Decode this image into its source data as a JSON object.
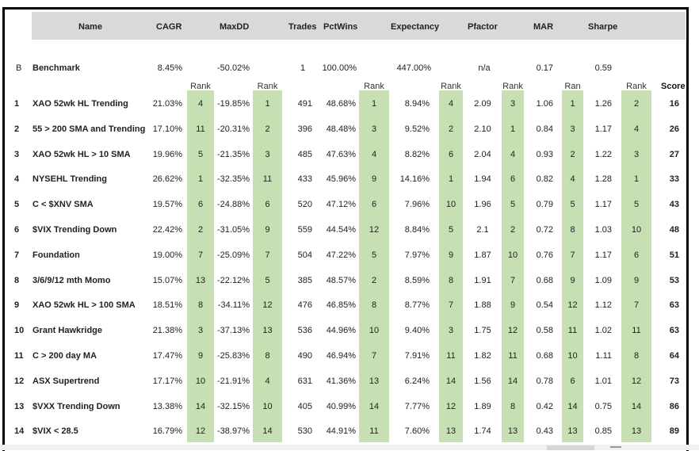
{
  "headers": {
    "name": "Name",
    "cagr": "CAGR",
    "maxdd": "MaxDD",
    "trades": "Trades",
    "pctwins": "PctWins",
    "expectancy": "Expectancy",
    "pfactor": "Pfactor",
    "mar": "MAR",
    "sharpe": "Sharpe",
    "score": "Score"
  },
  "rank_labels": [
    "Rank",
    "Rank",
    "Rank",
    "Rank",
    "Rank",
    "Ran",
    "Rank"
  ],
  "benchmark": {
    "id": "B",
    "name": "Benchmark",
    "cagr": "8.45%",
    "maxdd": "-50.02%",
    "trades": "1",
    "pctwins": "100.00%",
    "expectancy": "447.00%",
    "pfactor": "n/a",
    "mar": "0.17",
    "sharpe": "0.59"
  },
  "rows": [
    {
      "id": "1",
      "name": "XAO 52wk HL Trending",
      "cagr": "21.03%",
      "cagr_rank": "4",
      "maxdd": "-19.85%",
      "maxdd_rank": "1",
      "trades": "491",
      "pctwins": "48.68%",
      "pctwins_rank": "1",
      "expectancy": "8.94%",
      "expectancy_rank": "4",
      "pfactor": "2.09",
      "pfactor_rank": "3",
      "mar": "1.06",
      "mar_rank": "1",
      "sharpe": "1.26",
      "sharpe_rank": "2",
      "score": "16"
    },
    {
      "id": "2",
      "name": "55 > 200 SMA and Trending",
      "cagr": "17.10%",
      "cagr_rank": "11",
      "maxdd": "-20.31%",
      "maxdd_rank": "2",
      "trades": "396",
      "pctwins": "48.48%",
      "pctwins_rank": "3",
      "expectancy": "9.52%",
      "expectancy_rank": "2",
      "pfactor": "2.10",
      "pfactor_rank": "1",
      "mar": "0.84",
      "mar_rank": "3",
      "sharpe": "1.17",
      "sharpe_rank": "4",
      "score": "26"
    },
    {
      "id": "3",
      "name": "XAO 52wk HL > 10 SMA",
      "cagr": "19.96%",
      "cagr_rank": "5",
      "maxdd": "-21.35%",
      "maxdd_rank": "3",
      "trades": "485",
      "pctwins": "47.63%",
      "pctwins_rank": "4",
      "expectancy": "8.82%",
      "expectancy_rank": "6",
      "pfactor": "2.04",
      "pfactor_rank": "4",
      "mar": "0.93",
      "mar_rank": "2",
      "sharpe": "1.22",
      "sharpe_rank": "3",
      "score": "27"
    },
    {
      "id": "4",
      "name": "NYSEHL Trending",
      "cagr": "26.62%",
      "cagr_rank": "1",
      "maxdd": "-32.35%",
      "maxdd_rank": "11",
      "trades": "433",
      "pctwins": "45.96%",
      "pctwins_rank": "9",
      "expectancy": "14.16%",
      "expectancy_rank": "1",
      "pfactor": "1.94",
      "pfactor_rank": "6",
      "mar": "0.82",
      "mar_rank": "4",
      "sharpe": "1.28",
      "sharpe_rank": "1",
      "score": "33"
    },
    {
      "id": "5",
      "name": "C < $XNV SMA",
      "cagr": "19.57%",
      "cagr_rank": "6",
      "maxdd": "-24.88%",
      "maxdd_rank": "6",
      "trades": "520",
      "pctwins": "47.12%",
      "pctwins_rank": "6",
      "expectancy": "7.96%",
      "expectancy_rank": "10",
      "pfactor": "1.96",
      "pfactor_rank": "5",
      "mar": "0.79",
      "mar_rank": "5",
      "sharpe": "1.17",
      "sharpe_rank": "5",
      "score": "43"
    },
    {
      "id": "6",
      "name": "$VIX Trending Down",
      "cagr": "22.42%",
      "cagr_rank": "2",
      "maxdd": "-31.05%",
      "maxdd_rank": "9",
      "trades": "559",
      "pctwins": "44.54%",
      "pctwins_rank": "12",
      "expectancy": "8.84%",
      "expectancy_rank": "5",
      "pfactor": "2.1",
      "pfactor_rank": "2",
      "mar": "0.72",
      "mar_rank": "8",
      "sharpe": "1.03",
      "sharpe_rank": "10",
      "score": "48"
    },
    {
      "id": "7",
      "name": "Foundation",
      "cagr": "19.00%",
      "cagr_rank": "7",
      "maxdd": "-25.09%",
      "maxdd_rank": "7",
      "trades": "504",
      "pctwins": "47.22%",
      "pctwins_rank": "5",
      "expectancy": "7.97%",
      "expectancy_rank": "9",
      "pfactor": "1.87",
      "pfactor_rank": "10",
      "mar": "0.76",
      "mar_rank": "7",
      "sharpe": "1.17",
      "sharpe_rank": "6",
      "score": "51"
    },
    {
      "id": "8",
      "name": "3/6/9/12 mth Momo",
      "cagr": "15.07%",
      "cagr_rank": "13",
      "maxdd": "-22.12%",
      "maxdd_rank": "5",
      "trades": "385",
      "pctwins": "48.57%",
      "pctwins_rank": "2",
      "expectancy": "8.59%",
      "expectancy_rank": "8",
      "pfactor": "1.91",
      "pfactor_rank": "7",
      "mar": "0.68",
      "mar_rank": "9",
      "sharpe": "1.09",
      "sharpe_rank": "9",
      "score": "53"
    },
    {
      "id": "9",
      "name": "XAO 52wk HL > 100 SMA",
      "cagr": "18.51%",
      "cagr_rank": "8",
      "maxdd": "-34.11%",
      "maxdd_rank": "12",
      "trades": "476",
      "pctwins": "46.85%",
      "pctwins_rank": "8",
      "expectancy": "8.77%",
      "expectancy_rank": "7",
      "pfactor": "1.88",
      "pfactor_rank": "9",
      "mar": "0.54",
      "mar_rank": "12",
      "sharpe": "1.12",
      "sharpe_rank": "7",
      "score": "63"
    },
    {
      "id": "10",
      "name": "Grant Hawkridge",
      "cagr": "21.38%",
      "cagr_rank": "3",
      "maxdd": "-37.13%",
      "maxdd_rank": "13",
      "trades": "536",
      "pctwins": "44.96%",
      "pctwins_rank": "10",
      "expectancy": "9.40%",
      "expectancy_rank": "3",
      "pfactor": "1.75",
      "pfactor_rank": "12",
      "mar": "0.58",
      "mar_rank": "11",
      "sharpe": "1.02",
      "sharpe_rank": "11",
      "score": "63"
    },
    {
      "id": "11",
      "name": "C > 200 day MA",
      "cagr": "17.47%",
      "cagr_rank": "9",
      "maxdd": "-25.83%",
      "maxdd_rank": "8",
      "trades": "490",
      "pctwins": "46.94%",
      "pctwins_rank": "7",
      "expectancy": "7.91%",
      "expectancy_rank": "11",
      "pfactor": "1.82",
      "pfactor_rank": "11",
      "mar": "0.68",
      "mar_rank": "10",
      "sharpe": "1.11",
      "sharpe_rank": "8",
      "score": "64"
    },
    {
      "id": "12",
      "name": "ASX Supertrend",
      "cagr": "17.17%",
      "cagr_rank": "10",
      "maxdd": "-21.91%",
      "maxdd_rank": "4",
      "trades": "631",
      "pctwins": "41.36%",
      "pctwins_rank": "13",
      "expectancy": "6.24%",
      "expectancy_rank": "14",
      "pfactor": "1.56",
      "pfactor_rank": "14",
      "mar": "0.78",
      "mar_rank": "6",
      "sharpe": "1.01",
      "sharpe_rank": "12",
      "score": "73"
    },
    {
      "id": "13",
      "name": "$VXX Trending Down",
      "cagr": "13.38%",
      "cagr_rank": "14",
      "maxdd": "-32.15%",
      "maxdd_rank": "10",
      "trades": "405",
      "pctwins": "40.99%",
      "pctwins_rank": "14",
      "expectancy": "7.77%",
      "expectancy_rank": "12",
      "pfactor": "1.89",
      "pfactor_rank": "8",
      "mar": "0.42",
      "mar_rank": "14",
      "sharpe": "0.75",
      "sharpe_rank": "14",
      "score": "86"
    },
    {
      "id": "14",
      "name": "$VIX < 28.5",
      "cagr": "16.79%",
      "cagr_rank": "12",
      "maxdd": "-38.97%",
      "maxdd_rank": "14",
      "trades": "530",
      "pctwins": "44.91%",
      "pctwins_rank": "11",
      "expectancy": "7.60%",
      "expectancy_rank": "13",
      "pfactor": "1.74",
      "pfactor_rank": "13",
      "mar": "0.43",
      "mar_rank": "13",
      "sharpe": "0.85",
      "sharpe_rank": "13",
      "score": "89"
    }
  ],
  "colors": {
    "header_bg": "#d9d9d9",
    "rank_bg": "#c6e0b4",
    "frame": "#000000"
  }
}
